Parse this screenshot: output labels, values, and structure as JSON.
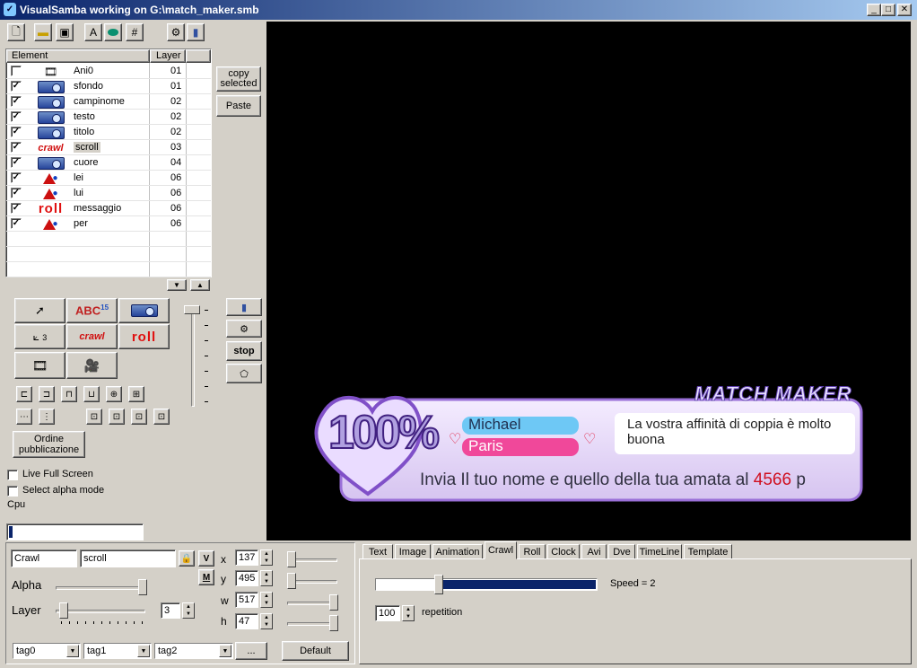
{
  "window": {
    "title": "VisualSamba working on G:\\match_maker.smb"
  },
  "list": {
    "header_element": "Element",
    "header_layer": "Layer",
    "rows": [
      {
        "checked": false,
        "icon": "animation-icon",
        "name": "Ani0",
        "layer": "01"
      },
      {
        "checked": true,
        "icon": "camera-icon",
        "name": "sfondo",
        "layer": "01"
      },
      {
        "checked": true,
        "icon": "camera-icon",
        "name": "campinome",
        "layer": "02"
      },
      {
        "checked": true,
        "icon": "camera-icon",
        "name": "testo",
        "layer": "02"
      },
      {
        "checked": true,
        "icon": "camera-icon",
        "name": "titolo",
        "layer": "02"
      },
      {
        "checked": true,
        "icon": "crawl-icon",
        "name": "scroll",
        "layer": "03"
      },
      {
        "checked": true,
        "icon": "camera-icon",
        "name": "cuore",
        "layer": "04"
      },
      {
        "checked": true,
        "icon": "shapes-icon",
        "name": "lei",
        "layer": "06"
      },
      {
        "checked": true,
        "icon": "shapes-icon",
        "name": "lui",
        "layer": "06"
      },
      {
        "checked": true,
        "icon": "roll-icon",
        "name": "messaggio",
        "layer": "06"
      },
      {
        "checked": true,
        "icon": "shapes-icon",
        "name": "per",
        "layer": "06"
      }
    ]
  },
  "side_buttons": {
    "copy": "copy selected",
    "paste": "Paste",
    "stop": "stop"
  },
  "tools": {
    "crawl": "crawl",
    "roll": "roll",
    "text_small": "15",
    "text_big": "ABC",
    "axis_z": "3"
  },
  "ordine": "Ordine pubblicazione",
  "options": {
    "live": "Live Full Screen",
    "alpha_mode": "Select alpha mode",
    "cpu": "Cpu"
  },
  "props": {
    "type": "Crawl",
    "name": "scroll",
    "v_label": "V",
    "m_label": "M",
    "alpha_label": "Alpha",
    "alpha_value": 1.0,
    "layer_label": "Layer",
    "layer_value": "3",
    "x_label": "x",
    "x": "137",
    "y_label": "y",
    "y": "495",
    "w_label": "w",
    "w": "517",
    "h_label": "h",
    "h": "47",
    "tag0": "tag0",
    "tag1": "tag1",
    "tag2": "tag2",
    "ellipsis": "...",
    "default": "Default"
  },
  "tabs": [
    "Text",
    "Image",
    "Animation",
    "Crawl",
    "Roll",
    "Clock",
    "Avi",
    "Dve",
    "TimeLine",
    "Template"
  ],
  "active_tab": "Crawl",
  "crawl": {
    "speed_label": "Speed = 2",
    "speed_fraction": 0.27,
    "repetition": "100",
    "repetition_label": "repetition"
  },
  "preview": {
    "brand": "MATCH MAKER",
    "percent": "100%",
    "name1": "Michael",
    "name2": "Paris",
    "message": "La vostra affinità di coppia è molto buona",
    "scroll_text": "Invia Il tuo nome e quello della tua amata al ",
    "scroll_number": "4566",
    "scroll_tail": " p",
    "colors": {
      "name1_bg": "#6ec8f5",
      "name2_bg": "#f0489a",
      "panel": "#e8d8f8",
      "number": "#d01020"
    }
  }
}
